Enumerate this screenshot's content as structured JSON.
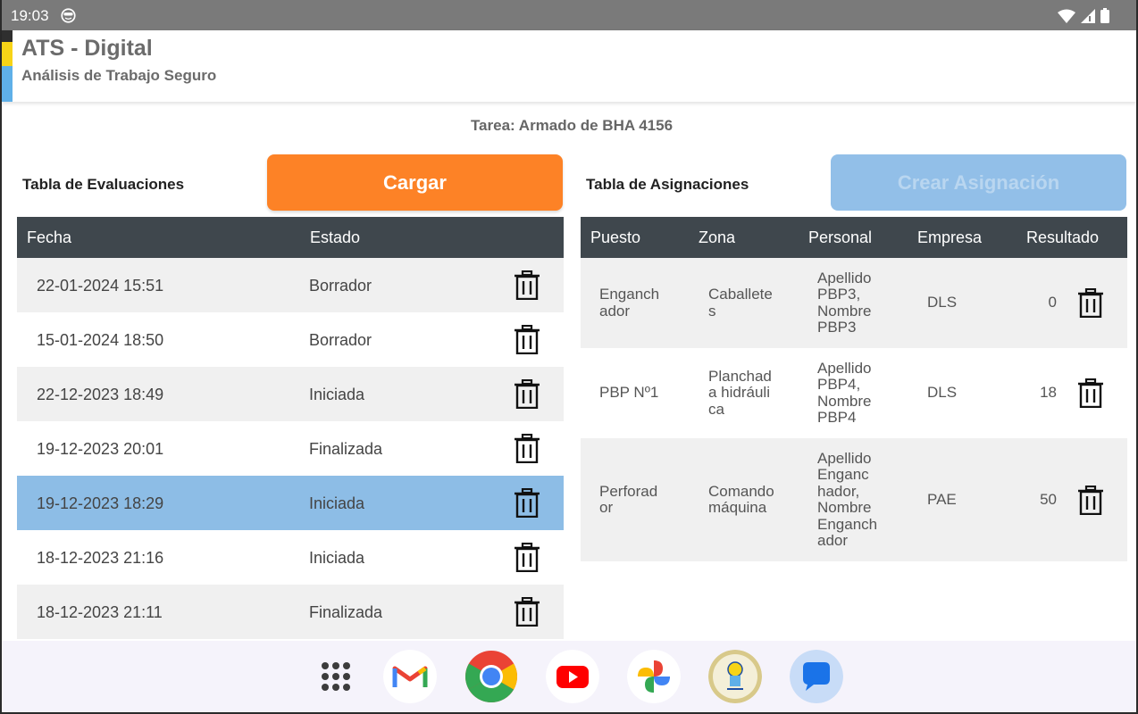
{
  "status_bar": {
    "time": "19:03",
    "icons": [
      "face-icon",
      "wifi-icon",
      "signal-icon",
      "battery-icon"
    ]
  },
  "app": {
    "title": "ATS - Digital",
    "subtitle": "Análisis de Trabajo Seguro",
    "stripe_colors": [
      "#2f2f2f",
      "#f7d417",
      "#5fb0e8"
    ]
  },
  "task_label": "Tarea: Armado de BHA 4156",
  "evaluaciones": {
    "section_title": "Tabla de Evaluaciones",
    "button_label": "Cargar",
    "button_color": "#fd8226",
    "columns": [
      "Fecha",
      "Estado"
    ],
    "rows": [
      {
        "fecha": "22-01-2024 15:51",
        "estado": "Borrador"
      },
      {
        "fecha": "15-01-2024 18:50",
        "estado": "Borrador"
      },
      {
        "fecha": "22-12-2023 18:49",
        "estado": "Iniciada"
      },
      {
        "fecha": "19-12-2023 20:01",
        "estado": "Finalizada"
      },
      {
        "fecha": "19-12-2023 18:29",
        "estado": "Iniciada"
      },
      {
        "fecha": "18-12-2023 21:16",
        "estado": "Iniciada"
      },
      {
        "fecha": "18-12-2023 21:11",
        "estado": "Finalizada"
      }
    ],
    "selected_row": 4
  },
  "asignaciones": {
    "section_title": "Tabla de Asignaciones",
    "button_label": "Crear Asignación",
    "button_color": "#92bfe8",
    "columns": [
      "Puesto",
      "Zona",
      "Personal",
      "Empresa",
      "Resultado"
    ],
    "rows": [
      {
        "puesto": [
          "Enganch",
          "ador"
        ],
        "zona": [
          "Caballete",
          "s"
        ],
        "personal": [
          "Apellido",
          "PBP3,",
          "Nombre",
          "PBP3"
        ],
        "empresa": "DLS",
        "resultado": "0"
      },
      {
        "puesto": [
          "PBP Nº1"
        ],
        "zona": [
          "Planchad",
          "a hidráuli",
          "ca"
        ],
        "personal": [
          "Apellido",
          "PBP4,",
          "Nombre",
          "PBP4"
        ],
        "empresa": "DLS",
        "resultado": "18"
      },
      {
        "puesto": [
          "Perforad",
          "or"
        ],
        "zona": [
          "Comando",
          "máquina"
        ],
        "personal": [
          "Apellido",
          "Enganc",
          "hador,",
          "Nombre",
          "Enganch",
          "ador"
        ],
        "empresa": "PAE",
        "resultado": "50"
      }
    ]
  },
  "dock": {
    "apps": [
      "app-drawer-icon",
      "gmail-icon",
      "chrome-icon",
      "youtube-icon",
      "photos-icon",
      "dls-app-icon",
      "messages-icon"
    ]
  }
}
